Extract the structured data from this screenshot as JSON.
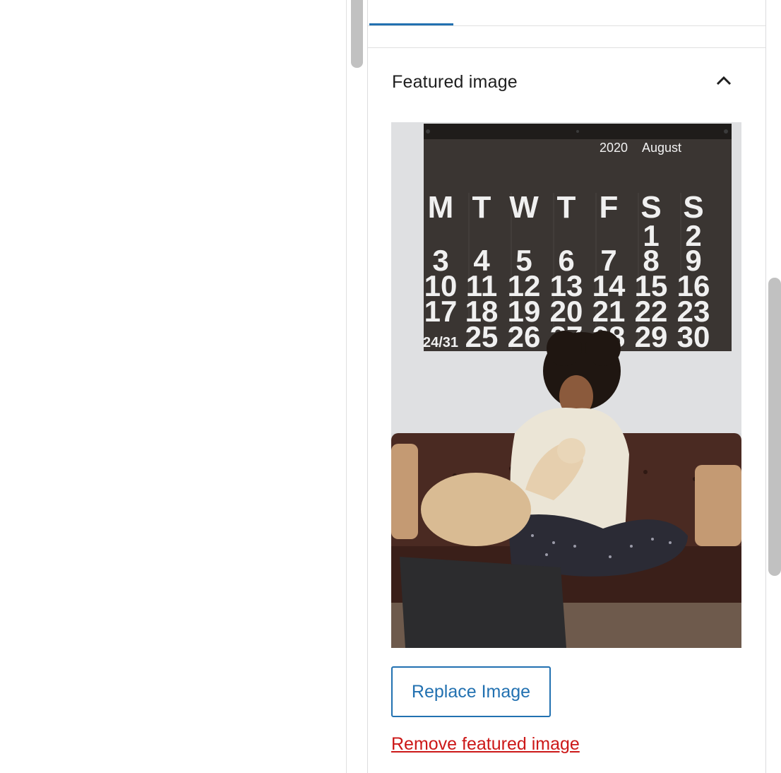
{
  "featured_image": {
    "title": "Featured image",
    "toggle_icon": "chevron-up-icon",
    "image": {
      "calendar_year": "2020",
      "calendar_month": "August",
      "weekdays": [
        "M",
        "T",
        "W",
        "T",
        "F",
        "S",
        "S"
      ],
      "weeks": [
        [
          "",
          "",
          "",
          "",
          "",
          "1",
          "2"
        ],
        [
          "3",
          "4",
          "5",
          "6",
          "7",
          "8",
          "9"
        ],
        [
          "10",
          "11",
          "12",
          "13",
          "14",
          "15",
          "16"
        ],
        [
          "17",
          "18",
          "19",
          "20",
          "21",
          "22",
          "23"
        ],
        [
          "24/31",
          "25",
          "26",
          "27",
          "28",
          "29",
          "30"
        ]
      ]
    },
    "replace_label": "Replace Image",
    "remove_label": "Remove featured image"
  },
  "colors": {
    "accent": "#2271b1",
    "danger": "#cc1818",
    "text": "#1e1e1e",
    "border": "#dcdcde"
  }
}
